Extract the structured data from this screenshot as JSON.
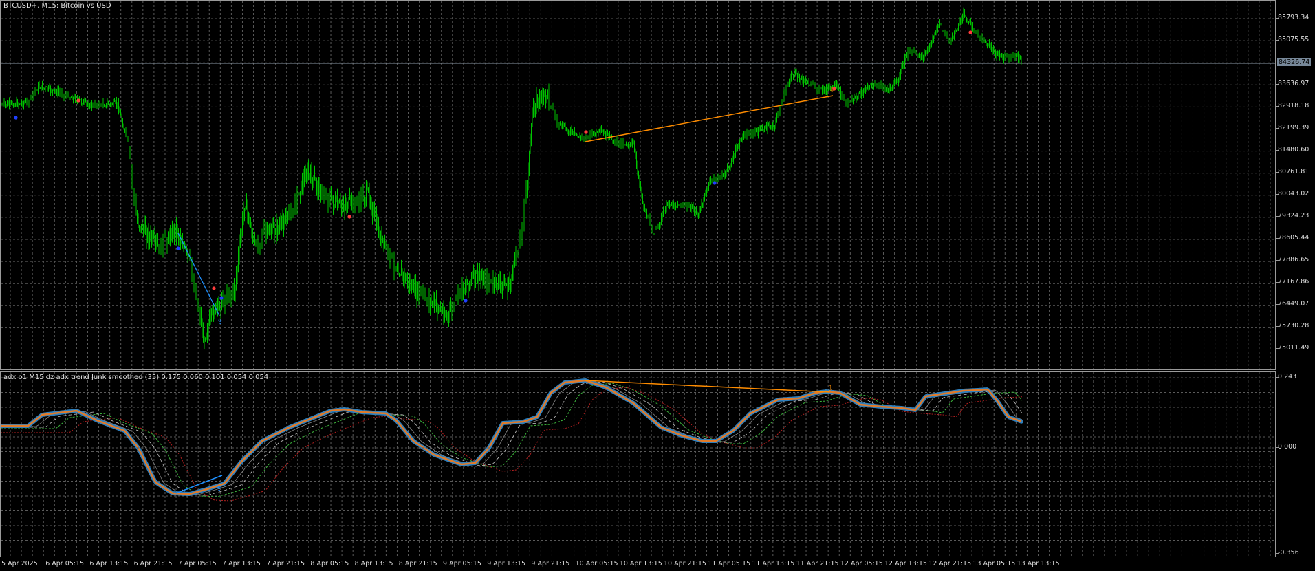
{
  "main_chart": {
    "title": "BTCUSD+, M15:  Bitcoin vs USD",
    "current_price": "84326.74",
    "price_labels": [
      "85793.34",
      "85075.55",
      "83636.97",
      "82918.18",
      "82199.39",
      "81480.60",
      "80761.81",
      "80043.02",
      "79324.23",
      "78605.44",
      "77886.65",
      "77167.86",
      "76449.07",
      "75730.28",
      "75011.49"
    ]
  },
  "indicator": {
    "title": "adx o1 M15 dz adx trend Junk smoothed (35) 0.175 0.060 0.101 0.054 0.054",
    "scale_labels": [
      "0.243",
      "0.000",
      "-0.356"
    ]
  },
  "time_axis": [
    "5 Apr 2025",
    "6 Apr 05:15",
    "6 Apr 13:15",
    "6 Apr 21:15",
    "7 Apr 05:15",
    "7 Apr 13:15",
    "7 Apr 21:15",
    "8 Apr 05:15",
    "8 Apr 13:15",
    "8 Apr 21:15",
    "9 Apr 05:15",
    "9 Apr 13:15",
    "9 Apr 21:15",
    "10 Apr 05:15",
    "10 Apr 13:15",
    "10 Apr 21:15",
    "11 Apr 05:15",
    "11 Apr 13:15",
    "11 Apr 21:15",
    "12 Apr 05:15",
    "12 Apr 13:15",
    "12 Apr 21:15",
    "13 Apr 05:15",
    "13 Apr 13:15"
  ],
  "colors": {
    "bars": "#00c400",
    "grid": "#5a5a5a",
    "trend_blue": "#2e7fbd",
    "trend_orange": "#e07b2a",
    "divergence_orange": "#ff8c00",
    "divergence_blue": "#1e90ff",
    "signal_red": "#ff3c3c",
    "signal_blue": "#2040ff",
    "level_green": "#3cb43c",
    "level_red": "#b42020",
    "level_grey": "#c8c8c8"
  }
}
